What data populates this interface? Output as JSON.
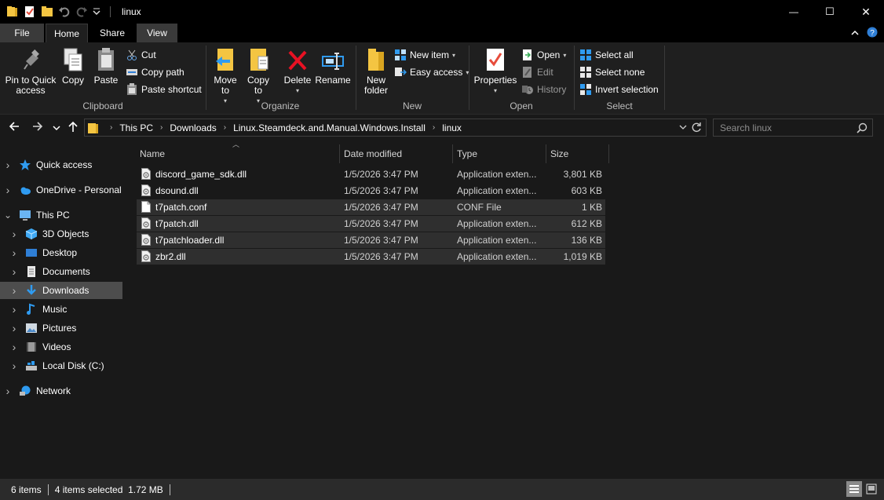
{
  "window": {
    "title": "linux",
    "minimize_glyph": "—",
    "maximize_glyph": "☐",
    "close_glyph": "✕"
  },
  "tabs": {
    "file": "File",
    "home": "Home",
    "share": "Share",
    "view": "View"
  },
  "ribbon": {
    "clipboard": {
      "label": "Clipboard",
      "pin": "Pin to Quick access",
      "copy": "Copy",
      "paste": "Paste",
      "cut": "Cut",
      "copy_path": "Copy path",
      "paste_shortcut": "Paste shortcut"
    },
    "organize": {
      "label": "Organize",
      "move_to": "Move to",
      "copy_to": "Copy to",
      "delete": "Delete",
      "rename": "Rename"
    },
    "new": {
      "label": "New",
      "new_folder": "New folder",
      "new_item": "New item",
      "easy_access": "Easy access"
    },
    "open": {
      "label": "Open",
      "properties": "Properties",
      "open": "Open",
      "edit": "Edit",
      "history": "History"
    },
    "select": {
      "label": "Select",
      "select_all": "Select all",
      "select_none": "Select none",
      "invert_selection": "Invert selection"
    }
  },
  "address": {
    "crumbs": [
      "This PC",
      "Downloads",
      "Linux.Steamdeck.and.Manual.Windows.Install",
      "linux"
    ]
  },
  "search": {
    "placeholder": "Search linux"
  },
  "navpane": {
    "items": [
      {
        "label": "Quick access",
        "icon": "star-icon",
        "level": 0,
        "expanded": false,
        "selected": false
      },
      {
        "label": "OneDrive - Personal",
        "icon": "cloud-icon",
        "level": 0,
        "expanded": false,
        "selected": false
      },
      {
        "label": "This PC",
        "icon": "computer-icon",
        "level": 0,
        "expanded": true,
        "selected": false
      },
      {
        "label": "3D Objects",
        "icon": "cube-icon",
        "level": 1,
        "expanded": false,
        "selected": false
      },
      {
        "label": "Desktop",
        "icon": "desktop-icon",
        "level": 1,
        "expanded": false,
        "selected": false
      },
      {
        "label": "Documents",
        "icon": "document-icon",
        "level": 1,
        "expanded": false,
        "selected": false
      },
      {
        "label": "Downloads",
        "icon": "download-icon",
        "level": 1,
        "expanded": false,
        "selected": true
      },
      {
        "label": "Music",
        "icon": "music-icon",
        "level": 1,
        "expanded": false,
        "selected": false
      },
      {
        "label": "Pictures",
        "icon": "pictures-icon",
        "level": 1,
        "expanded": false,
        "selected": false
      },
      {
        "label": "Videos",
        "icon": "videos-icon",
        "level": 1,
        "expanded": false,
        "selected": false
      },
      {
        "label": "Local Disk (C:)",
        "icon": "disk-icon",
        "level": 1,
        "expanded": false,
        "selected": false
      },
      {
        "label": "Network",
        "icon": "network-icon",
        "level": 0,
        "expanded": false,
        "selected": false
      }
    ]
  },
  "filelist": {
    "columns": {
      "name": "Name",
      "date": "Date modified",
      "type": "Type",
      "size": "Size"
    },
    "rows": [
      {
        "name": "discord_game_sdk.dll",
        "date": "1/5/2026 3:47 PM",
        "type": "Application exten...",
        "size": "3,801 KB",
        "selected": false,
        "icon": "dll-file-icon"
      },
      {
        "name": "dsound.dll",
        "date": "1/5/2026 3:47 PM",
        "type": "Application exten...",
        "size": "603 KB",
        "selected": false,
        "icon": "dll-file-icon"
      },
      {
        "name": "t7patch.conf",
        "date": "1/5/2026 3:47 PM",
        "type": "CONF File",
        "size": "1 KB",
        "selected": true,
        "icon": "file-icon"
      },
      {
        "name": "t7patch.dll",
        "date": "1/5/2026 3:47 PM",
        "type": "Application exten...",
        "size": "612 KB",
        "selected": true,
        "icon": "dll-file-icon"
      },
      {
        "name": "t7patchloader.dll",
        "date": "1/5/2026 3:47 PM",
        "type": "Application exten...",
        "size": "136 KB",
        "selected": true,
        "icon": "dll-file-icon"
      },
      {
        "name": "zbr2.dll",
        "date": "1/5/2026 3:47 PM",
        "type": "Application exten...",
        "size": "1,019 KB",
        "selected": true,
        "icon": "dll-file-icon"
      }
    ]
  },
  "status": {
    "items_count": "6 items",
    "selected": "4 items selected  1.72 MB"
  },
  "colors": {
    "background": "#191919",
    "titlebar": "#000000",
    "ribbon": "#1f1f1f",
    "selection": "#4d4d4d",
    "accent_blue": "#2f9bf0",
    "folder_yellow": "#f4c542",
    "delete_red": "#e81123"
  }
}
